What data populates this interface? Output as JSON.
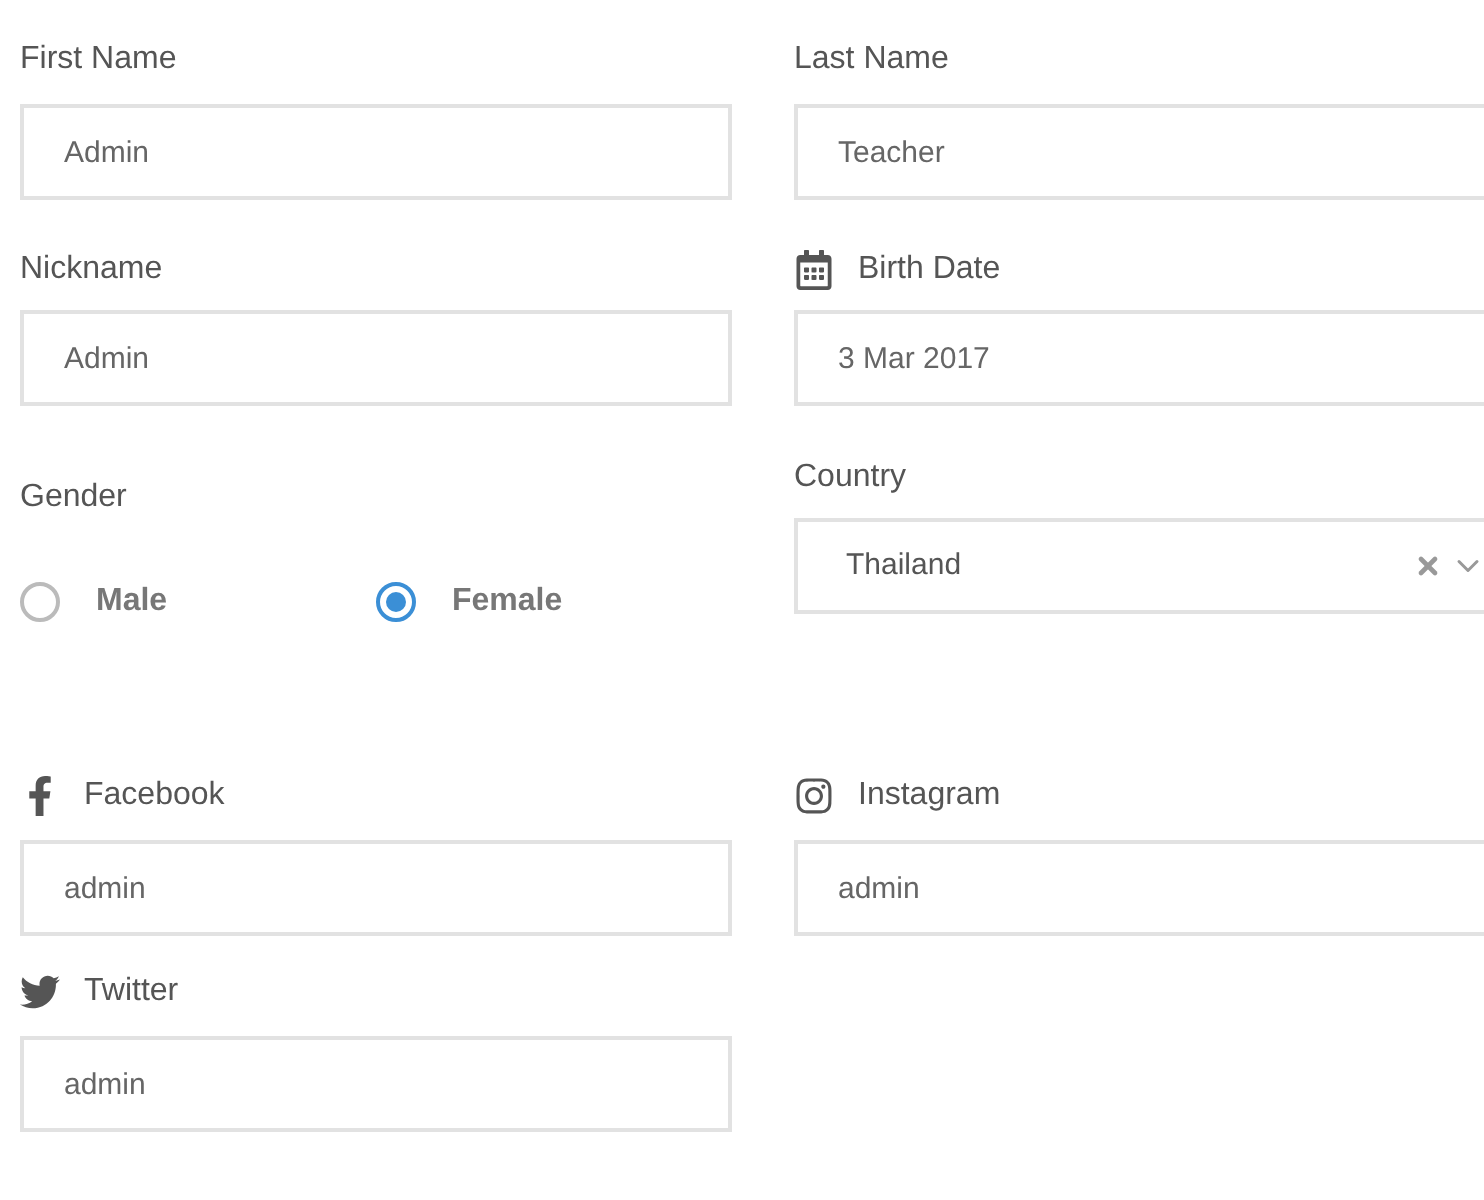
{
  "first_name": {
    "label": "First Name",
    "value": "Admin"
  },
  "last_name": {
    "label": "Last Name",
    "value": "Teacher"
  },
  "nickname": {
    "label": "Nickname",
    "value": "Admin"
  },
  "birth_date": {
    "label": "Birth Date",
    "value": "3 Mar 2017"
  },
  "gender": {
    "label": "Gender",
    "options": [
      {
        "label": "Male",
        "selected": false
      },
      {
        "label": "Female",
        "selected": true
      }
    ]
  },
  "country": {
    "label": "Country",
    "value": "Thailand"
  },
  "facebook": {
    "label": "Facebook",
    "value": "admin"
  },
  "instagram": {
    "label": "Instagram",
    "value": "admin"
  },
  "twitter": {
    "label": "Twitter",
    "value": "admin"
  }
}
